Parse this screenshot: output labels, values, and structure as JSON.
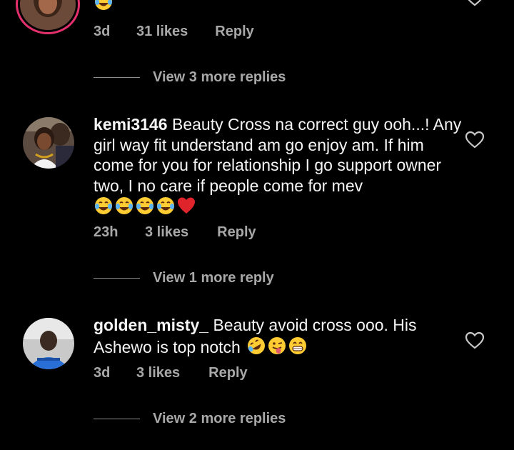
{
  "comments": [
    {
      "username": "",
      "text": "",
      "emojis": [
        "face-with-tears-of-joy"
      ],
      "time": "3d",
      "likes": "31 likes",
      "reply_label": "Reply",
      "view_replies": "View 3 more replies"
    },
    {
      "username": "kemi3146",
      "text": "Beauty Cross na correct guy ooh...! Any girl way fit understand am go enjoy am. If him come for you for relationship I go support owner two, I no care if people come for mev",
      "emojis": [
        "face-with-tears-of-joy",
        "face-with-tears-of-joy",
        "face-with-tears-of-joy",
        "face-with-tears-of-joy",
        "red-heart"
      ],
      "time": "23h",
      "likes": "3 likes",
      "reply_label": "Reply",
      "view_replies": "View 1 more reply"
    },
    {
      "username": "golden_misty_",
      "text": "Beauty avoid cross ooo. His Ashewo is top notch",
      "emojis": [
        "rolling-on-floor-laughing",
        "winking-face-with-tongue",
        "grinning-face-with-smiling-eyes"
      ],
      "time": "3d",
      "likes": "3 likes",
      "reply_label": "Reply",
      "view_replies": "View 2 more replies"
    }
  ],
  "colors": {
    "background": "#000000",
    "primary_text": "#f5f5f5",
    "secondary_text": "#a8a8a8",
    "story_ring": "#e1306c"
  }
}
